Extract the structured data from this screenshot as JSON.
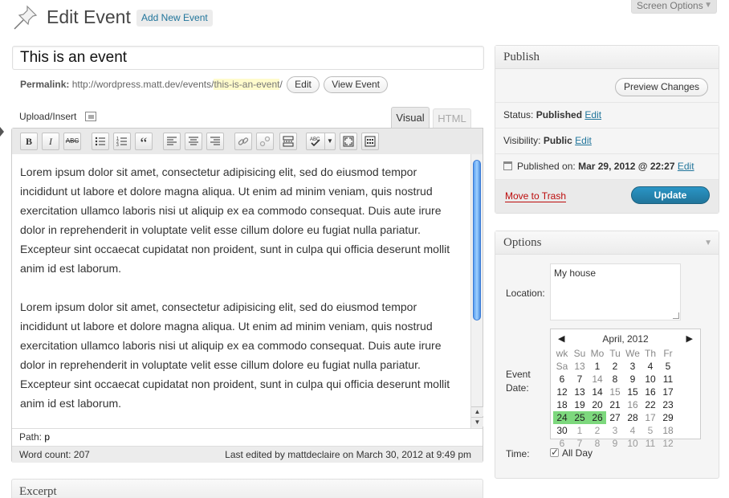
{
  "screen_options": {
    "label": "Screen Options",
    "arrow": "▼"
  },
  "header": {
    "title": "Edit Event",
    "add_new": "Add New Event"
  },
  "post": {
    "title": "This is an event",
    "permalink_label": "Permalink:",
    "permalink_base": "http://wordpress.matt.dev/events/",
    "permalink_slug": "this-is-an-event",
    "permalink_trail": "/",
    "edit_label": "Edit",
    "view_label": "View Event"
  },
  "editor": {
    "upload_label": "Upload/Insert",
    "tab_visual": "Visual",
    "tab_html": "HTML",
    "paragraphs": [
      "Lorem ipsum dolor sit amet, consectetur adipisicing elit, sed do eiusmod tempor incididunt ut labore et dolore magna aliqua. Ut enim ad minim veniam, quis nostrud exercitation ullamco laboris nisi ut aliquip ex ea commodo consequat. Duis aute irure dolor in reprehenderit in voluptate velit esse cillum dolore eu fugiat nulla pariatur. Excepteur sint occaecat cupidatat non proident, sunt in culpa qui officia deserunt mollit anim id est laborum.",
      "Lorem ipsum dolor sit amet, consectetur adipisicing elit, sed do eiusmod tempor incididunt ut labore et dolore magna aliqua. Ut enim ad minim veniam, quis nostrud exercitation ullamco laboris nisi ut aliquip ex ea commodo consequat. Duis aute irure dolor in reprehenderit in voluptate velit esse cillum dolore eu fugiat nulla pariatur. Excepteur sint occaecat cupidatat non proident, sunt in culpa qui officia deserunt mollit anim id est laborum."
    ],
    "path_label": "Path:",
    "path_value": "p",
    "word_count": "Word count: 207",
    "last_edited": "Last edited by mattdeclaire on March 30, 2012 at 9:49 pm",
    "toolbar": {
      "bold": "B",
      "italic": "I",
      "strike": "ABC",
      "quote": "“"
    }
  },
  "excerpt": {
    "title": "Excerpt"
  },
  "publish": {
    "title": "Publish",
    "preview": "Preview Changes",
    "status_label": "Status:",
    "status_value": "Published",
    "visibility_label": "Visibility:",
    "visibility_value": "Public",
    "published_label": "Published on:",
    "published_value": "Mar 29, 2012 @ 22:27",
    "edit": "Edit",
    "trash": "Move to Trash",
    "update": "Update"
  },
  "options": {
    "title": "Options",
    "location_label": "Location:",
    "location_value": "My house",
    "date_label_1": "Event",
    "date_label_2": "Date:",
    "time_label": "Time:",
    "all_day": "All Day",
    "all_day_checked": true,
    "calendar": {
      "month": "April, 2012",
      "prev": "◀",
      "next": "▶",
      "dow": [
        "wk",
        "Su",
        "Mo",
        "Tu",
        "We",
        "Th",
        "Fr",
        "Sa"
      ],
      "rows": [
        [
          "13",
          "1",
          "2",
          "3",
          "4",
          "5",
          "6",
          "7"
        ],
        [
          "14",
          "8",
          "9",
          "10",
          "11",
          "12",
          "13",
          "14"
        ],
        [
          "15",
          "15",
          "16",
          "17",
          "18",
          "19",
          "20",
          "21"
        ],
        [
          "16",
          "22",
          "23",
          "24",
          "25",
          "26",
          "27",
          "28"
        ],
        [
          "17",
          "29",
          "30",
          "1",
          "2",
          "3",
          "4",
          "5"
        ],
        [
          "18",
          "6",
          "7",
          "8",
          "9",
          "10",
          "11",
          "12"
        ]
      ],
      "selected": [
        "24",
        "25",
        "26"
      ],
      "selected_color": "#7dd87d"
    }
  },
  "colors": {
    "link": "#21759b",
    "trash": "#bc0b0b",
    "update": "#21759b"
  }
}
